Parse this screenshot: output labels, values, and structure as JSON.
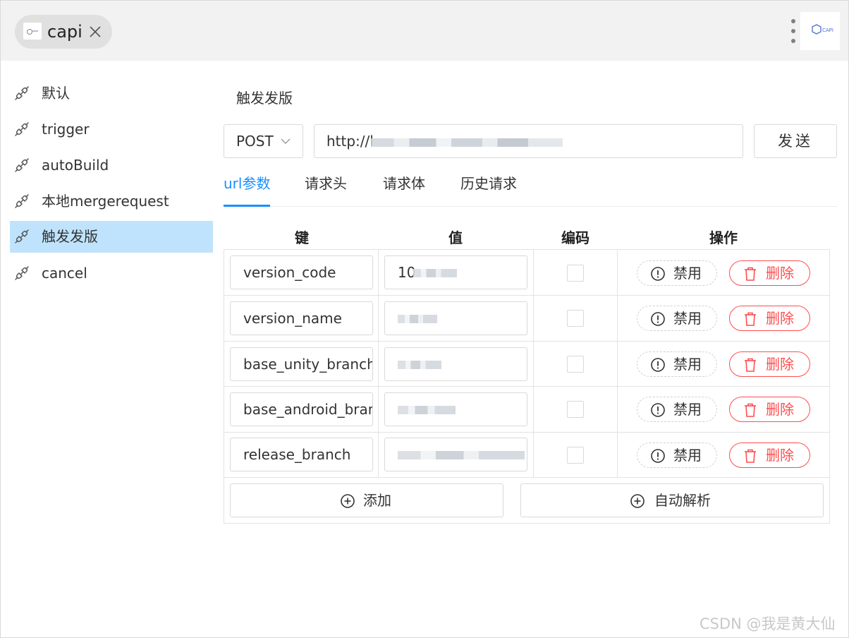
{
  "tab": {
    "title": "capi",
    "logo_icon": "capi-logo-icon",
    "close_icon": "close-icon"
  },
  "header": {
    "menu_icon": "more-vertical-icon",
    "logo_icon": "capi-app-logo",
    "logo_text": "CAPI"
  },
  "sidebar": {
    "items": [
      {
        "label": "默认",
        "icon": "link-icon",
        "active": false
      },
      {
        "label": "trigger",
        "icon": "link-icon",
        "active": false
      },
      {
        "label": "autoBuild",
        "icon": "link-icon",
        "active": false
      },
      {
        "label": "本地mergerequest",
        "icon": "link-icon",
        "active": false
      },
      {
        "label": "触发发版",
        "icon": "link-icon",
        "active": true
      },
      {
        "label": "cancel",
        "icon": "link-icon",
        "active": false
      }
    ]
  },
  "request": {
    "title": "触发发版",
    "method": "POST",
    "url": "http://l",
    "send_label": "发送"
  },
  "tabs": [
    {
      "label": "url参数",
      "active": true
    },
    {
      "label": "请求头",
      "active": false
    },
    {
      "label": "请求体",
      "active": false
    },
    {
      "label": "历史请求",
      "active": false
    }
  ],
  "params_table": {
    "headers": {
      "key": "键",
      "value": "值",
      "encode": "编码",
      "actions": "操作"
    },
    "rows": [
      {
        "key": "version_code",
        "value": "10",
        "encoded": false
      },
      {
        "key": "version_name",
        "value": "",
        "encoded": false
      },
      {
        "key": "base_unity_branch",
        "value": "",
        "encoded": false
      },
      {
        "key": "base_android_bran",
        "value": "",
        "encoded": false
      },
      {
        "key": "release_branch",
        "value": "",
        "encoded": false
      }
    ],
    "disable_label": "禁用",
    "delete_label": "删除"
  },
  "footer_buttons": {
    "add_label": "添加",
    "parse_label": "自动解析"
  },
  "watermark": "CSDN @我是黄大仙",
  "colors": {
    "accent": "#1890ff",
    "danger": "#ff4d4f",
    "selected_bg": "#bfe3fc",
    "topbar_bg": "#f2f2f2"
  }
}
